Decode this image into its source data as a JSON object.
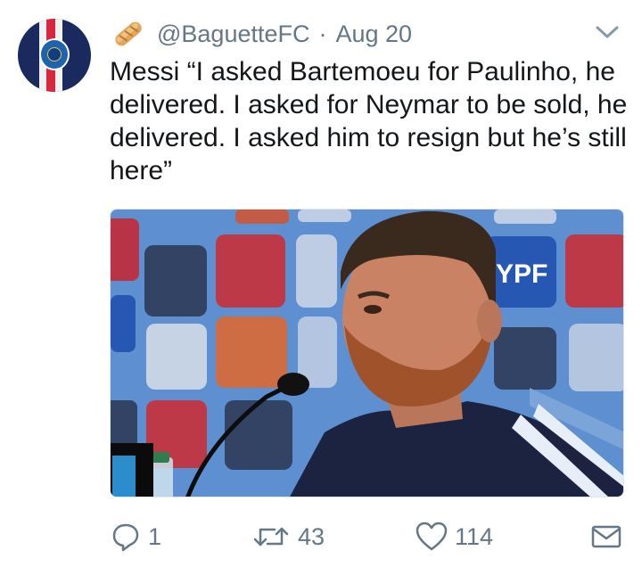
{
  "tweet": {
    "handle": "@BaguetteFC",
    "separator": "·",
    "date": "Aug 20",
    "text": "Messi “I asked Bartemoeu for Paulinho, he delivered. I asked for Neymar to be sold, he delivered. I asked him to resign but he’s still here”",
    "emoji_icon": "baguette-icon",
    "menu_icon": "chevron-down-icon"
  },
  "photo": {
    "backdrop_logos": [
      "YPF"
    ]
  },
  "actions": {
    "reply_count": "1",
    "retweet_count": "43",
    "like_count": "114",
    "reply_icon": "reply-icon",
    "retweet_icon": "retweet-icon",
    "like_icon": "heart-icon",
    "dm_icon": "envelope-icon"
  },
  "colors": {
    "muted": "#657786",
    "text": "#14171a",
    "avatar_navy": "#1a2a5e",
    "avatar_red": "#d7263d"
  }
}
